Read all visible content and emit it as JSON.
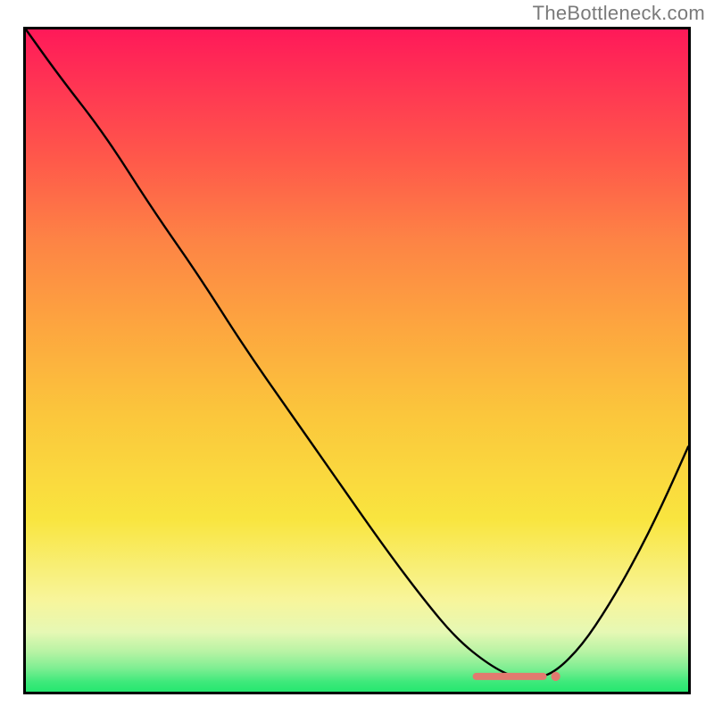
{
  "attribution": "TheBottleneck.com",
  "chart_data": {
    "type": "line",
    "title": "",
    "xlabel": "",
    "ylabel": "",
    "xlim": [
      0,
      1
    ],
    "ylim": [
      0,
      1
    ],
    "legend": false,
    "grid": false,
    "series": [
      {
        "name": "bottleneck-curve",
        "x": [
          0.0,
          0.05,
          0.12,
          0.19,
          0.26,
          0.33,
          0.4,
          0.47,
          0.54,
          0.6,
          0.65,
          0.7,
          0.74,
          0.77,
          0.8,
          0.84,
          0.88,
          0.92,
          0.96,
          1.0
        ],
        "y": [
          1.0,
          0.93,
          0.84,
          0.73,
          0.63,
          0.52,
          0.42,
          0.32,
          0.22,
          0.14,
          0.08,
          0.04,
          0.02,
          0.02,
          0.03,
          0.07,
          0.13,
          0.2,
          0.28,
          0.37
        ],
        "note": "Normalized: x is fraction across plot width left→right, y is fraction of plot height bottom→top. Curve starts at top-left, descends to a minimum near x≈0.75, then rises toward the right edge."
      }
    ],
    "markers": {
      "note": "horizontal cluster of salmon/pink dots sitting at the trough, roughly x in [0.68,0.80], y≈0.023",
      "color": "#E27A6F",
      "x_start": 0.68,
      "x_end": 0.8,
      "y": 0.023
    },
    "background_gradient": {
      "direction": "top-to-bottom",
      "stops": [
        {
          "pos": 0.0,
          "color": "#FF1959"
        },
        {
          "pos": 0.2,
          "color": "#FF5A4A"
        },
        {
          "pos": 0.45,
          "color": "#FDA63F"
        },
        {
          "pos": 0.74,
          "color": "#F9E53F"
        },
        {
          "pos": 0.86,
          "color": "#F8F59A"
        },
        {
          "pos": 0.92,
          "color": "#E6F8B4"
        },
        {
          "pos": 0.97,
          "color": "#7DEE92"
        },
        {
          "pos": 1.0,
          "color": "#25E770"
        }
      ]
    }
  }
}
